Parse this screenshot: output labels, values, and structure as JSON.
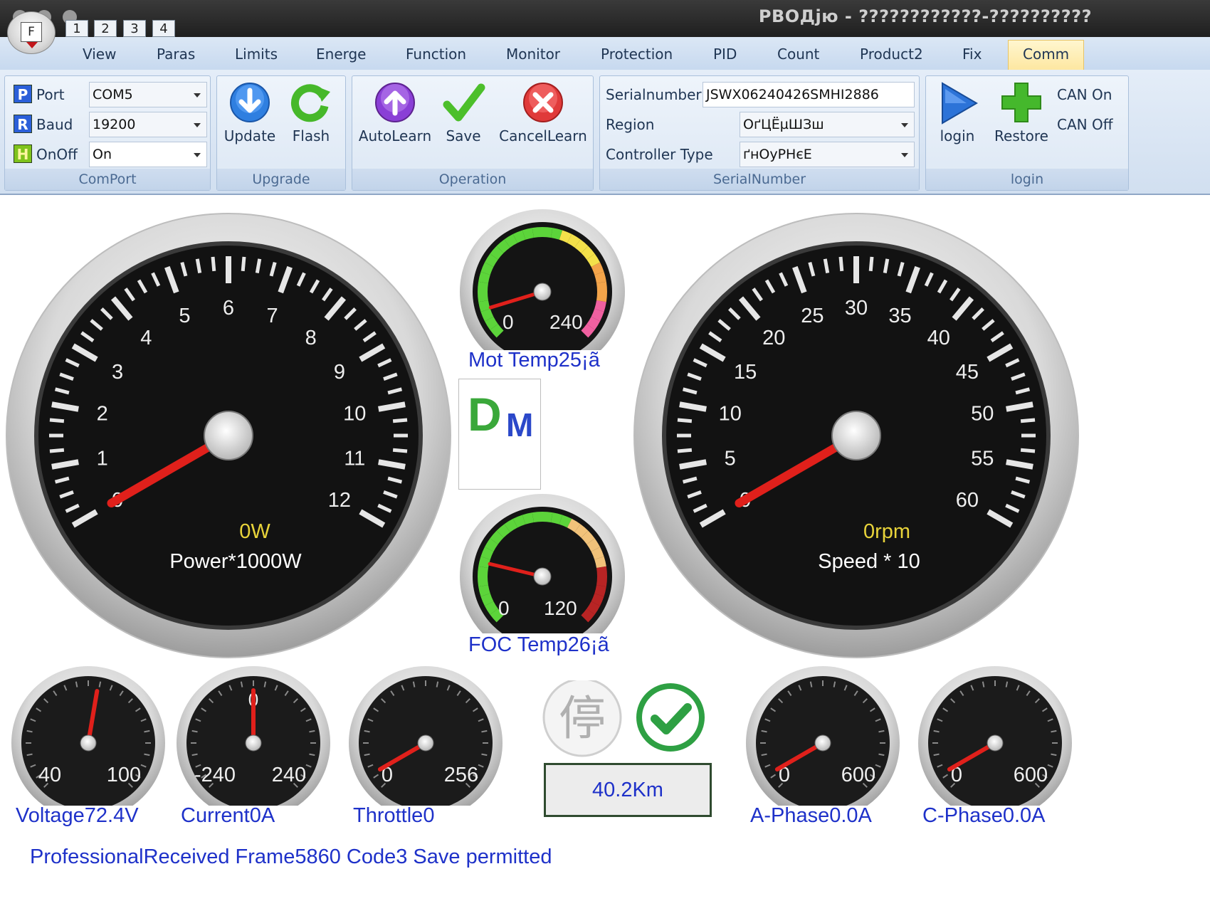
{
  "window": {
    "title": "РВОДјю - ????????????-??????????",
    "quick_tabs": [
      "1",
      "2",
      "3",
      "4"
    ],
    "app_button_letter": "F"
  },
  "ribbon": {
    "tabs": [
      "View",
      "Paras",
      "Limits",
      "Energe",
      "Function",
      "Monitor",
      "Protection",
      "PID",
      "Count",
      "Product2",
      "Fix",
      "Comm"
    ],
    "active_tab": "Comm",
    "comport": {
      "caption": "ComPort",
      "port_badge": "P",
      "port_label": "Port",
      "port_value": "COM5",
      "baud_badge": "R",
      "baud_label": "Baud",
      "baud_value": "19200",
      "onoff_badge": "H",
      "onoff_label": "OnOff",
      "onoff_value": "On"
    },
    "upgrade": {
      "caption": "Upgrade",
      "update_label": "Update",
      "flash_label": "Flash"
    },
    "operation": {
      "caption": "Operation",
      "autolearn_label": "AutoLearn",
      "save_label": "Save",
      "cancellearn_label": "CancelLearn"
    },
    "serialnumber": {
      "caption": "SerialNumber",
      "serial_label": "Serialnumber",
      "serial_value": "JSWX06240426SMHI2886",
      "region_label": "Region",
      "region_value": "ОґЦЁµШЗш",
      "controller_label": "Controller Type",
      "controller_value": "ґнОуРНєЕ"
    },
    "login": {
      "caption": "login",
      "login_label": "login",
      "restore_label": "Restore",
      "can_on_label": "CAN On",
      "can_off_label": "CAN Off"
    }
  },
  "gauges": {
    "power": {
      "ticks": [
        "0",
        "1",
        "2",
        "3",
        "4",
        "5",
        "6",
        "7",
        "8",
        "9",
        "10",
        "11",
        "12"
      ],
      "value_text": "0W",
      "caption": "Power*1000W",
      "value": 0
    },
    "speed": {
      "ticks": [
        "0",
        "5",
        "10",
        "15",
        "20",
        "25",
        "30",
        "35",
        "40",
        "45",
        "50",
        "55",
        "60"
      ],
      "value_text": "0rpm",
      "caption": "Speed * 10",
      "value": 0
    },
    "mot_temp": {
      "min_label": "0",
      "max_label": "240",
      "label": "Mot Temp25¡ã",
      "value": 25
    },
    "foc_temp": {
      "min_label": "0",
      "max_label": "120",
      "label": "FOC Temp26¡ã",
      "value": 26
    },
    "voltage": {
      "min_label": "40",
      "max_label": "100",
      "label": "Voltage72.4V",
      "value": 72.4
    },
    "current": {
      "min_label": "-240",
      "max_label": "240",
      "mid_label": "0",
      "label": "Current0A",
      "value": 0
    },
    "throttle": {
      "min_label": "0",
      "max_label": "256",
      "label": "Throttle0",
      "value": 0
    },
    "a_phase": {
      "min_label": "0",
      "max_label": "600",
      "label": "A-Phase0.0A",
      "value": 0
    },
    "c_phase": {
      "min_label": "0",
      "max_label": "600",
      "label": "C-Phase0.0A",
      "value": 0
    }
  },
  "logo": {
    "letter1": "D",
    "letter2": "M"
  },
  "indicators": {
    "stop_glyph": "停",
    "odometer": "40.2Km"
  },
  "status": "ProfessionalReceived Frame5860 Code3 Save permitted",
  "colors": {
    "accent_text": "#1e31c9",
    "needle": "#e0201b",
    "value_text": "#e8d33a",
    "ok_green": "#2ea043"
  }
}
